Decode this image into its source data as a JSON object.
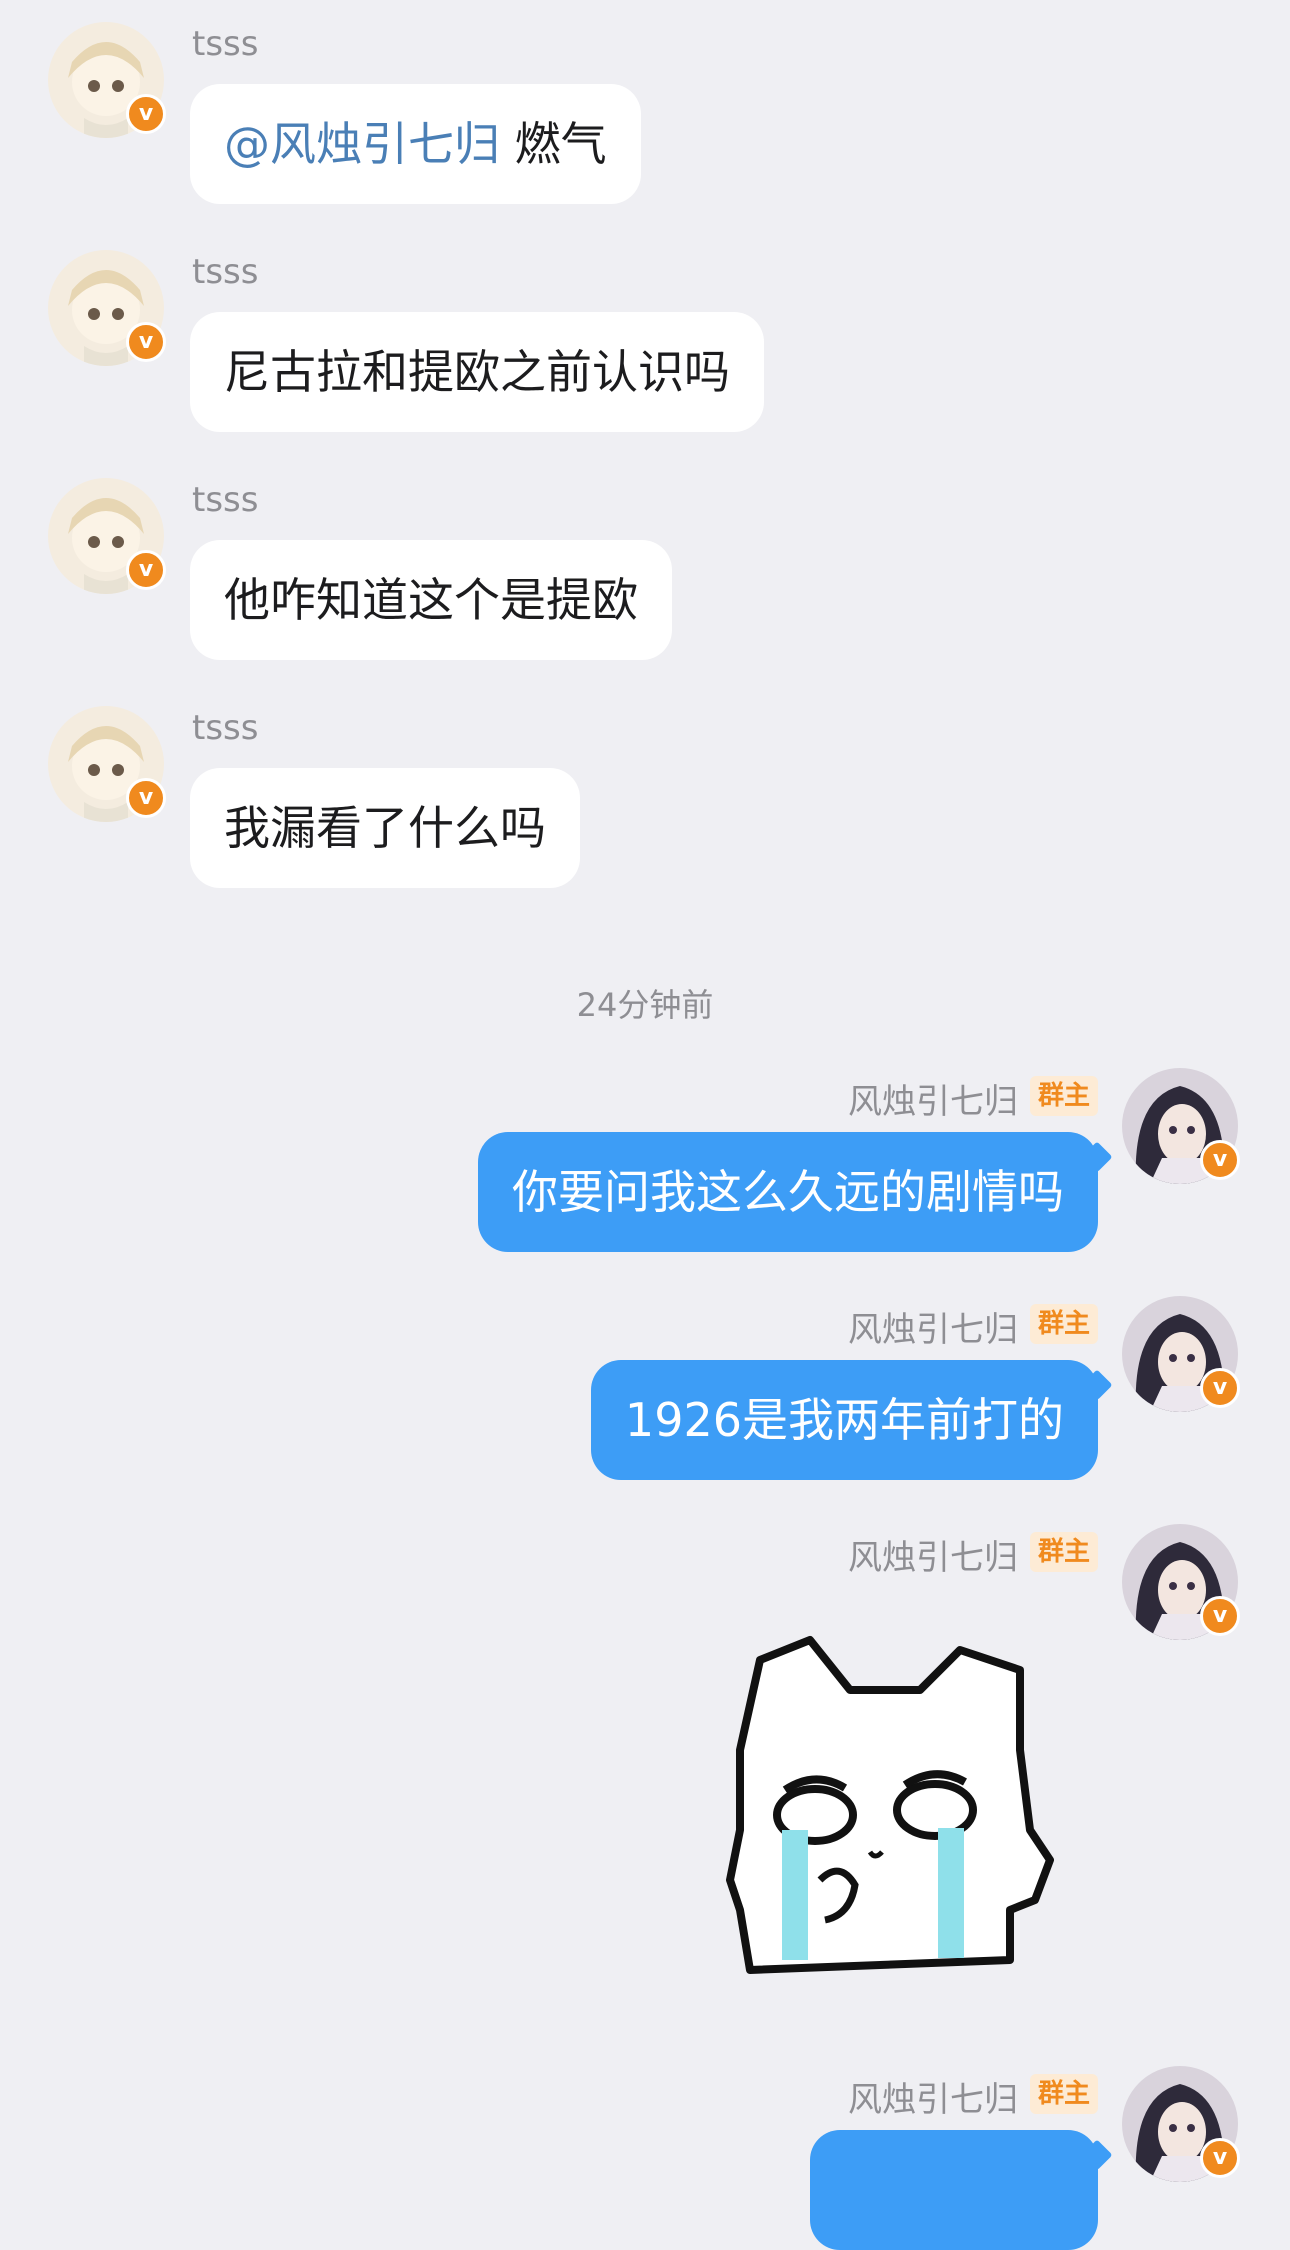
{
  "incoming": [
    {
      "name": "tsss",
      "mention": "@风烛引七归",
      "text": "燃气"
    },
    {
      "name": "tsss",
      "mention": "",
      "text": "尼古拉和提欧之前认识吗"
    },
    {
      "name": "tsss",
      "mention": "",
      "text": "他咋知道这个是提欧"
    },
    {
      "name": "tsss",
      "mention": "",
      "text": "我漏看了什么吗"
    }
  ],
  "timestamp": "24分钟前",
  "outgoing": [
    {
      "name": "风烛引七归",
      "role": "群主",
      "text": "你要问我这么久远的剧情吗"
    },
    {
      "name": "风烛引七归",
      "role": "群主",
      "text": "1926是我两年前打的"
    },
    {
      "name": "风烛引七归",
      "role": "群主",
      "sticker": "crying-cat-sticker"
    },
    {
      "name": "风烛引七归",
      "role": "群主",
      "text": ""
    }
  ],
  "icons": {
    "verified": "v-badge-icon"
  },
  "colors": {
    "outgoing_bubble": "#3d9df6",
    "badge": "#f08a1e",
    "mention": "#4a7fb6"
  }
}
